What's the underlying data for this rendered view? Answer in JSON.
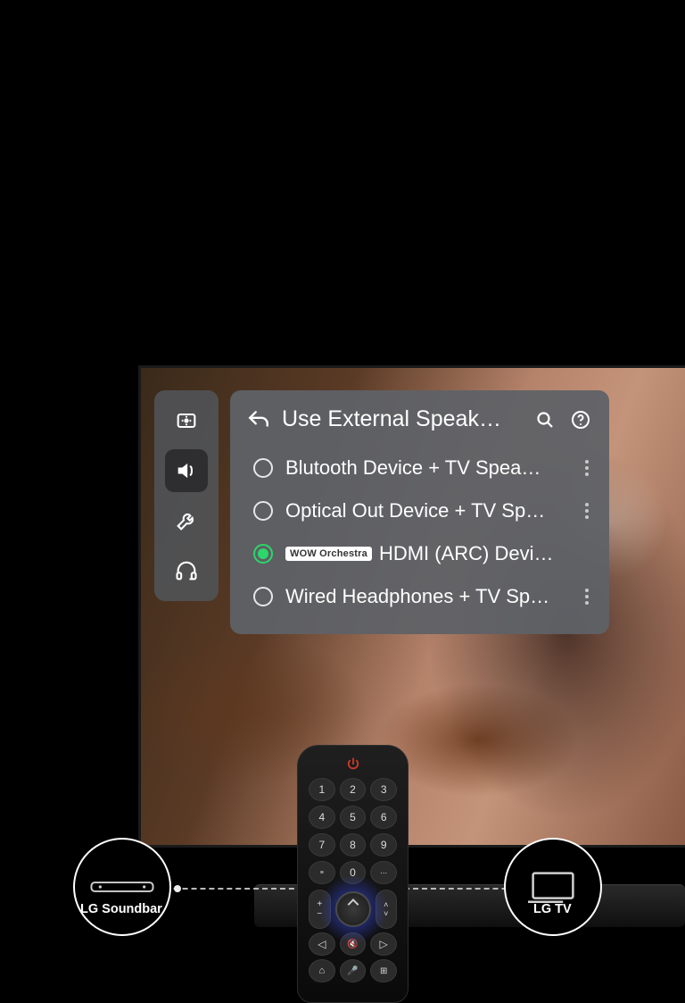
{
  "panel": {
    "title": "Use External Speak…",
    "options": [
      {
        "label": "Blutooth Device + TV Spea…",
        "selected": false,
        "badge": null
      },
      {
        "label": "Optical Out Device + TV Sp…",
        "selected": false,
        "badge": null
      },
      {
        "label": "HDMI (ARC) Devi…",
        "selected": true,
        "badge": "WOW Orchestra"
      },
      {
        "label": "Wired Headphones + TV Sp…",
        "selected": false,
        "badge": null
      }
    ]
  },
  "sidebar": {
    "items": [
      "brightness",
      "sound",
      "tools",
      "support"
    ],
    "active_index": 1
  },
  "remote": {
    "numbers": [
      "1",
      "2",
      "3",
      "4",
      "5",
      "6",
      "7",
      "8",
      "9",
      "",
      "0",
      ""
    ]
  },
  "badges": {
    "soundbar_label": "LG Soundbar",
    "tv_label": "LG TV"
  }
}
